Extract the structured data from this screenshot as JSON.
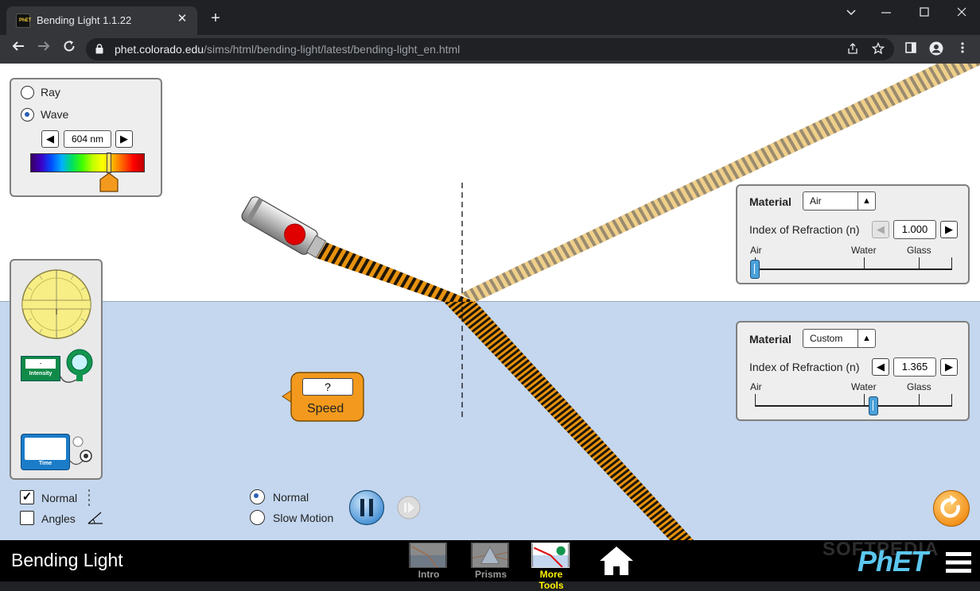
{
  "browser": {
    "tab_title": "Bending Light 1.1.22",
    "new_tab_symbol": "+",
    "tab_close_symbol": "✕",
    "url_host": "phet.colorado.edu",
    "url_path": "/sims/html/bending-light/latest/bending-light_en.html",
    "icons": [
      "back-icon",
      "forward-icon",
      "reload-icon",
      "lock-icon",
      "share-icon",
      "star-icon",
      "sidebar-icon",
      "profile-icon",
      "menu-kebab-icon",
      "minimize-icon",
      "maximize-icon",
      "close-icon",
      "tab-search-icon"
    ]
  },
  "light_panel": {
    "ray_label": "Ray",
    "wave_label": "Wave",
    "selected": "Wave",
    "wavelength_value": "604 nm",
    "wavelength_fraction": 0.69
  },
  "top_medium": {
    "material_label": "Material",
    "material_value": "Air",
    "ior_label": "Index of Refraction (n)",
    "ior_value": "1.000",
    "slider_labels": [
      "Air",
      "Water",
      "Glass"
    ],
    "slider_fraction": 0.0
  },
  "bottom_medium": {
    "material_label": "Material",
    "material_value": "Custom",
    "ior_label": "Index of Refraction (n)",
    "ior_value": "1.365",
    "slider_labels": [
      "Air",
      "Water",
      "Glass"
    ],
    "slider_fraction": 0.6
  },
  "speed_tool": {
    "value": "?",
    "label": "Speed"
  },
  "toolbox": {
    "intensity_label": "Intensity",
    "intensity_value": "-",
    "time_label": "Time"
  },
  "checkboxes": {
    "normal_label": "Normal",
    "normal_checked": true,
    "angles_label": "Angles",
    "angles_checked": false,
    "check_mark": "✓"
  },
  "time_controls": {
    "normal_label": "Normal",
    "slow_label": "Slow Motion",
    "selected": "Normal"
  },
  "navbar": {
    "sim_title": "Bending Light",
    "screens": [
      {
        "label": "Intro",
        "active": false
      },
      {
        "label": "Prisms",
        "active": false
      },
      {
        "label": "More Tools",
        "active": true
      }
    ],
    "brand": "PhET",
    "watermark": "SOFTPEDIA"
  },
  "colors": {
    "water": "#c4d7ef",
    "beam_dark": "#1e1608",
    "beam_light": "#e8920e",
    "accent_orange": "#f39a1e",
    "play_blue": "#4d9fe0",
    "active_screen": "#fff200"
  }
}
